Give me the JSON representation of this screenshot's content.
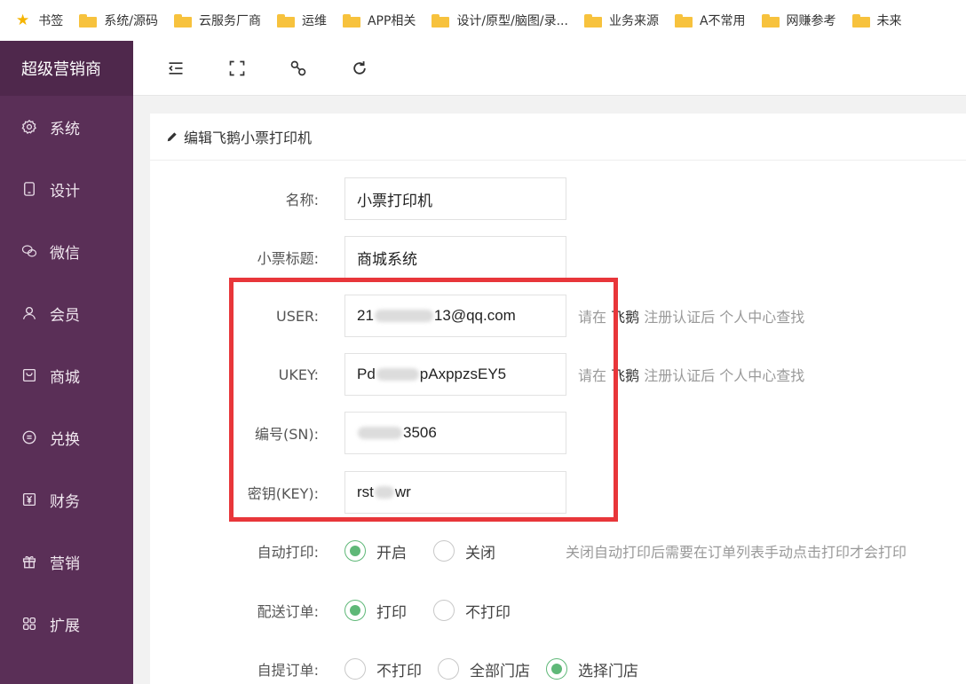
{
  "bookmarks": [
    "书签",
    "系统/源码",
    "云服务厂商",
    "运维",
    "APP相关",
    "设计/原型/脑图/录...",
    "业务来源",
    "A不常用",
    "网赚参考",
    "未来"
  ],
  "sidebar": {
    "brand": "超级营销商",
    "items": [
      {
        "label": "系统",
        "icon": "gear-icon"
      },
      {
        "label": "设计",
        "icon": "tablet-icon"
      },
      {
        "label": "微信",
        "icon": "wechat-icon"
      },
      {
        "label": "会员",
        "icon": "user-icon"
      },
      {
        "label": "商城",
        "icon": "shop-icon"
      },
      {
        "label": "兑换",
        "icon": "coin-icon"
      },
      {
        "label": "财务",
        "icon": "yen-icon"
      },
      {
        "label": "营销",
        "icon": "gift-icon"
      },
      {
        "label": "扩展",
        "icon": "grid-icon"
      }
    ]
  },
  "toolbar": {
    "icons": [
      "collapse-menu-icon",
      "fullscreen-icon",
      "link-icon",
      "refresh-icon"
    ]
  },
  "panel": {
    "title": "编辑飞鹅小票打印机"
  },
  "form": {
    "name": {
      "label": "名称:",
      "value": "小票打印机"
    },
    "ticket_title": {
      "label": "小票标题:",
      "value": "商城系统"
    },
    "user": {
      "label": "USER:",
      "value_pre": "21",
      "value_post": "13@qq.com",
      "hint_pre": "请在",
      "hint_strong": "飞鹅",
      "hint_post": "注册认证后 个人中心查找"
    },
    "ukey": {
      "label": "UKEY:",
      "value_pre": "Pd",
      "value_post": "pAxppzsEY5",
      "hint_pre": "请在",
      "hint_strong": "飞鹅",
      "hint_post": "注册认证后 个人中心查找"
    },
    "sn": {
      "label": "编号(SN):",
      "value_pre": "",
      "value_post": "3506"
    },
    "key": {
      "label": "密钥(KEY):",
      "value_pre": "rst",
      "value_post": "wr"
    },
    "auto_print": {
      "label": "自动打印:",
      "options": [
        "开启",
        "关闭"
      ],
      "selected": 0,
      "hint": "关闭自动打印后需要在订单列表手动点击打印才会打印"
    },
    "delivery_order": {
      "label": "配送订单:",
      "options": [
        "打印",
        "不打印"
      ],
      "selected": 0
    },
    "pickup_order": {
      "label": "自提订单:",
      "options": [
        "不打印",
        "全部门店",
        "选择门店"
      ],
      "selected": 2
    }
  },
  "colors": {
    "sidebar": "#5a2f57",
    "accent_green": "#5fb878",
    "highlight_red": "#e8363a"
  }
}
